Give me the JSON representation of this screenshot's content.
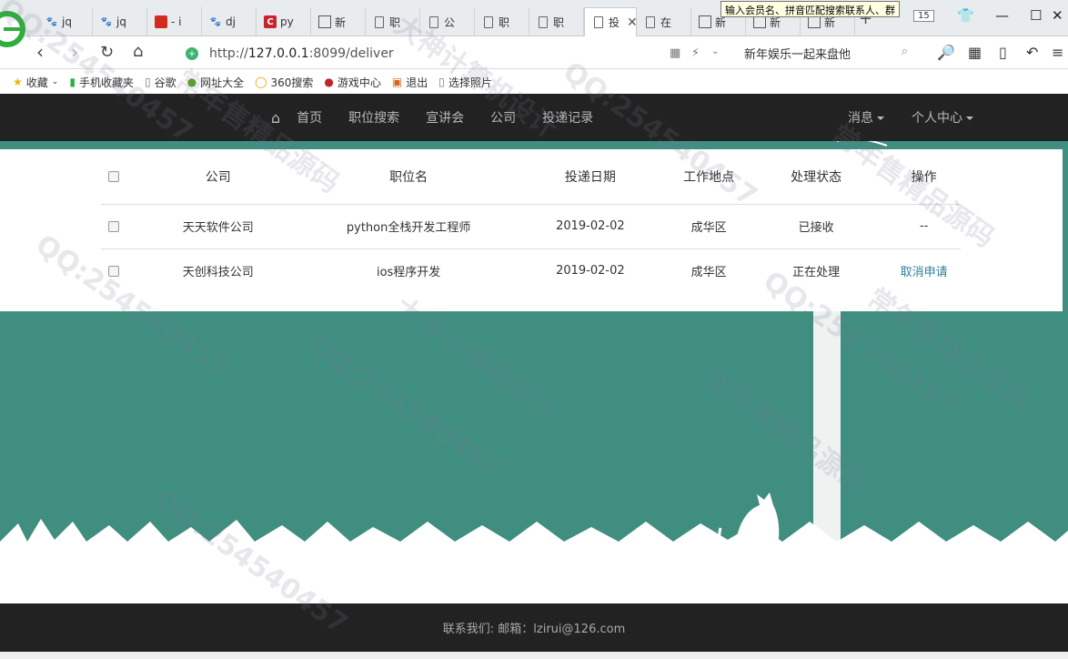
{
  "browser": {
    "tabs": [
      {
        "icon": "paw-icon",
        "label": "jq"
      },
      {
        "icon": "paw-icon",
        "label": "jq"
      },
      {
        "icon": "red-icon",
        "label": "- i"
      },
      {
        "icon": "paw-icon",
        "label": "dj"
      },
      {
        "icon": "c-icon",
        "label": "py"
      },
      {
        "icon": "grid-icon",
        "label": "新"
      },
      {
        "icon": "doc-icon",
        "label": "职"
      },
      {
        "icon": "doc-icon",
        "label": "公"
      },
      {
        "icon": "doc-icon",
        "label": "职"
      },
      {
        "icon": "doc-icon",
        "label": "职"
      },
      {
        "icon": "doc-icon",
        "label": "投"
      },
      {
        "icon": "doc-icon",
        "label": "在"
      },
      {
        "icon": "grid-icon",
        "label": "新"
      },
      {
        "icon": "grid-icon",
        "label": "新"
      },
      {
        "icon": "grid-icon",
        "label": "新"
      }
    ],
    "tooltip": "输入会员名、拼音匹配搜索联系人、群",
    "tab_count": "15",
    "url_prefix": "http://",
    "url_host": "127.0.0.1",
    "url_rest": ":8099/deliver",
    "search_text": "新年娱乐一起来盘他",
    "bookmarks": [
      {
        "icon": "star-icon",
        "label": "收藏"
      },
      {
        "icon": "phone-icon",
        "label": "手机收藏夹"
      },
      {
        "icon": "doc-icon",
        "label": "谷歌"
      },
      {
        "icon": "globe-icon",
        "label": "网址大全"
      },
      {
        "icon": "ring-icon",
        "label": "360搜索"
      },
      {
        "icon": "game-icon",
        "label": "游戏中心"
      },
      {
        "icon": "exit-icon",
        "label": "退出"
      },
      {
        "icon": "doc-icon",
        "label": "选择照片"
      }
    ]
  },
  "nav": {
    "links": [
      "首页",
      "职位搜索",
      "宣讲会",
      "公司",
      "投递记录"
    ],
    "messages": "消息",
    "profile": "个人中心"
  },
  "table": {
    "headers": [
      "公司",
      "职位名",
      "投递日期",
      "工作地点",
      "处理状态",
      "操作"
    ],
    "rows": [
      {
        "company": "天天软件公司",
        "position": "python全栈开发工程师",
        "date": "2019-02-02",
        "location": "成华区",
        "status": "已接收",
        "action": "--"
      },
      {
        "company": "天创科技公司",
        "position": "ios程序开发",
        "date": "2019-02-02",
        "location": "成华区",
        "status": "正在处理",
        "action": "取消申请"
      }
    ]
  },
  "footer": {
    "text": "联系我们:  邮箱：lzirui@126.com"
  },
  "watermark": [
    "QQ:254540457",
    "常年售精品源码",
    "大神计算机设计"
  ]
}
